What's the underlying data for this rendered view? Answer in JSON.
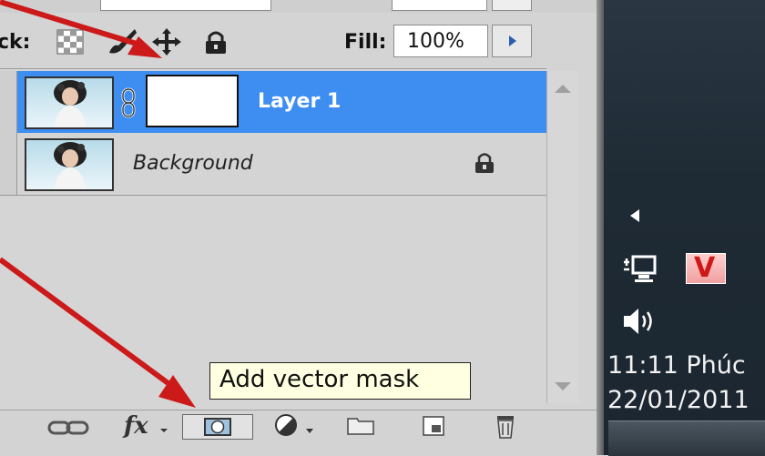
{
  "lock_row": {
    "label": "ck:",
    "fill_label": "Fill:",
    "fill_value": "100%"
  },
  "layers": [
    {
      "name": "Layer 1",
      "selected": true,
      "has_mask": true
    },
    {
      "name": "Background",
      "selected": false,
      "locked": true
    }
  ],
  "tooltip": "Add vector mask",
  "bottom_bar": {
    "icons": [
      "link-layers-icon",
      "fx-icon",
      "add-mask-icon",
      "adjustment-layer-icon",
      "new-group-icon",
      "new-layer-icon",
      "trash-icon"
    ],
    "fx_label": "fx"
  },
  "taskbar": {
    "clock_time": "11:11 Phúc",
    "clock_date": "22/01/2011",
    "tray_v_label": "V"
  },
  "colors": {
    "selection": "#3e8ef2",
    "arrow": "#cc1a1a",
    "tooltip_bg": "#ffffe1"
  }
}
